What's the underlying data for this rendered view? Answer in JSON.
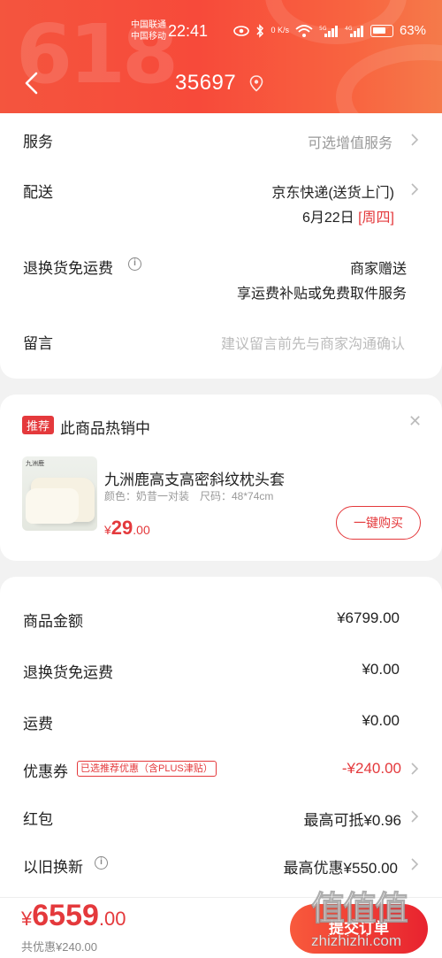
{
  "status_bar": {
    "carrier1": "中国联通",
    "carrier2": "中国移动",
    "time": "22:41",
    "net_speed": "0 K/s",
    "battery": "63%"
  },
  "header": {
    "bg_text": "618",
    "address": "35697"
  },
  "order_info": {
    "service_label": "服务",
    "service_value": "可选增值服务",
    "delivery_label": "配送",
    "delivery_value": "京东快递(送货上门)",
    "delivery_date": "6月22日",
    "delivery_weekday": "[周四]",
    "return_label": "退换货免运费",
    "return_value": "商家赠送",
    "return_sub": "享运费补贴或免费取件服务",
    "message_label": "留言",
    "message_placeholder": "建议留言前先与商家沟通确认"
  },
  "recommend": {
    "tag": "推荐",
    "title": "此商品热销中",
    "brand_mini": "九洲鹿",
    "product_name": "九洲鹿高支高密斜纹枕头套",
    "product_spec": "颜色：奶昔一对装　尺码：48*74cm",
    "price_yen": "¥",
    "price_int": "29",
    "price_dec": ".00",
    "buy_label": "一键购买"
  },
  "summary": {
    "goods_label": "商品金额",
    "goods_value": "¥6799.00",
    "return_label": "退换货免运费",
    "return_value": "¥0.00",
    "freight_label": "运费",
    "freight_value": "¥0.00",
    "coupon_label": "优惠券",
    "coupon_tag": "已选推荐优惠（含PLUS津贴）",
    "coupon_value": "-¥240.00",
    "redpacket_label": "红包",
    "redpacket_value": "最高可抵¥0.96",
    "tradein_label": "以旧换新",
    "tradein_value": "最高优惠¥550.00"
  },
  "bottom": {
    "total_yen": "¥",
    "total_int": "6559",
    "total_dec": ".00",
    "saved": "共优惠¥240.00",
    "submit_label": "提交订单",
    "watermark_logo": "值值值",
    "watermark_text": "zhizhizhi.com"
  },
  "colors": {
    "accent": "#e4393c",
    "header_start": "#f4553e",
    "header_end": "#f57a4a"
  }
}
